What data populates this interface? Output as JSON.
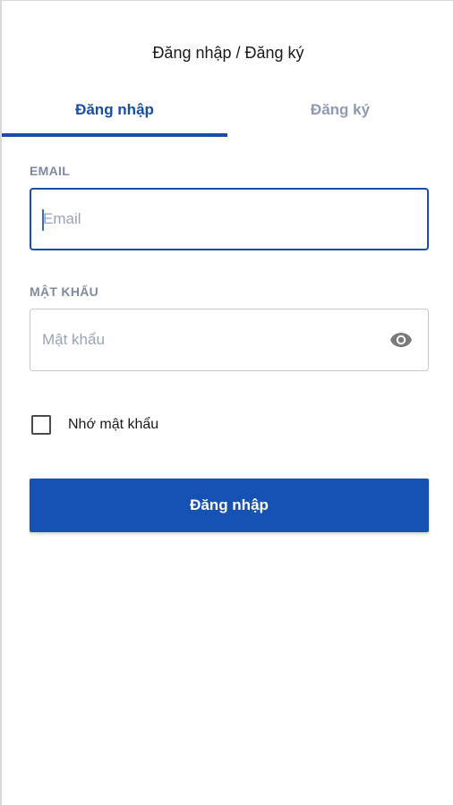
{
  "header": {
    "title": "Đăng nhập / Đăng ký"
  },
  "tabs": [
    {
      "label": "Đăng nhập",
      "active": true
    },
    {
      "label": "Đăng ký",
      "active": false
    }
  ],
  "form": {
    "email": {
      "label": "EMAIL",
      "placeholder": "Email",
      "value": ""
    },
    "password": {
      "label": "MẬT KHẨU",
      "placeholder": "Mật khẩu",
      "value": "",
      "toggle_icon": "eye-icon"
    },
    "remember": {
      "label": "Nhớ mật khẩu",
      "checked": false
    },
    "submit_label": "Đăng nhập"
  },
  "colors": {
    "primary": "#174ea6",
    "button": "#1552b4",
    "label": "#7f8aa1",
    "tab_inactive": "#8e9aaf"
  }
}
